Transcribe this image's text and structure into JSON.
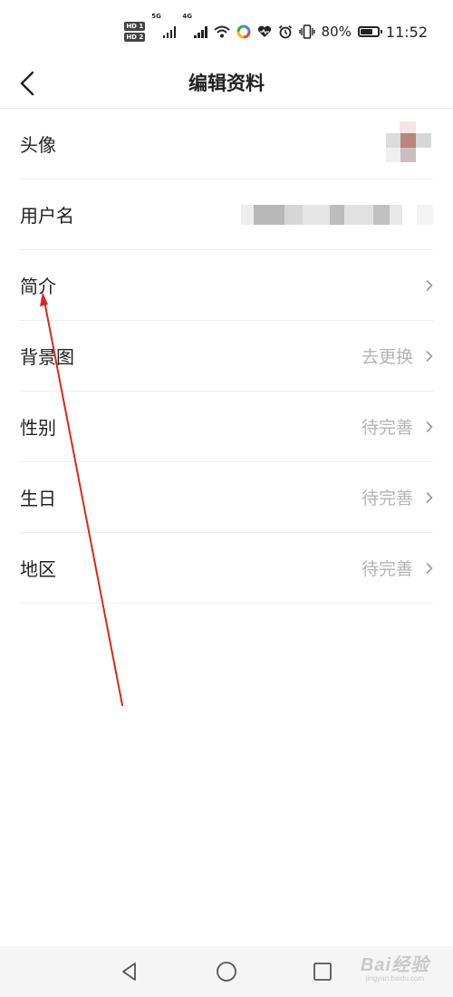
{
  "status_bar": {
    "hd1": "HD 1",
    "hd2": "HD 2",
    "net1": "5G",
    "net2": "4G",
    "battery_percent": "80%",
    "battery_level": 0.8,
    "time": "11:52",
    "icons": [
      "wifi-icon",
      "app-colorful-icon",
      "health-heart-icon",
      "alarm-icon",
      "vibrate-icon",
      "battery-icon"
    ]
  },
  "header": {
    "title": "编辑资料",
    "back_icon": "chevron-left-icon"
  },
  "rows": [
    {
      "label": "头像",
      "value": ""
    },
    {
      "label": "用户名",
      "value": ""
    },
    {
      "label": "简介",
      "value": ""
    },
    {
      "label": "背景图",
      "value": "去更换"
    },
    {
      "label": "性别",
      "value": "待完善"
    },
    {
      "label": "生日",
      "value": "待完善"
    },
    {
      "label": "地区",
      "value": "待完善"
    }
  ],
  "annotation": {
    "color": "#d9291c"
  },
  "nav_bar": {
    "icons": [
      "nav-back-icon",
      "nav-home-icon",
      "nav-recents-icon"
    ],
    "watermark": "Bai经验",
    "watermark_sub": "jingyan.baidu.com"
  }
}
